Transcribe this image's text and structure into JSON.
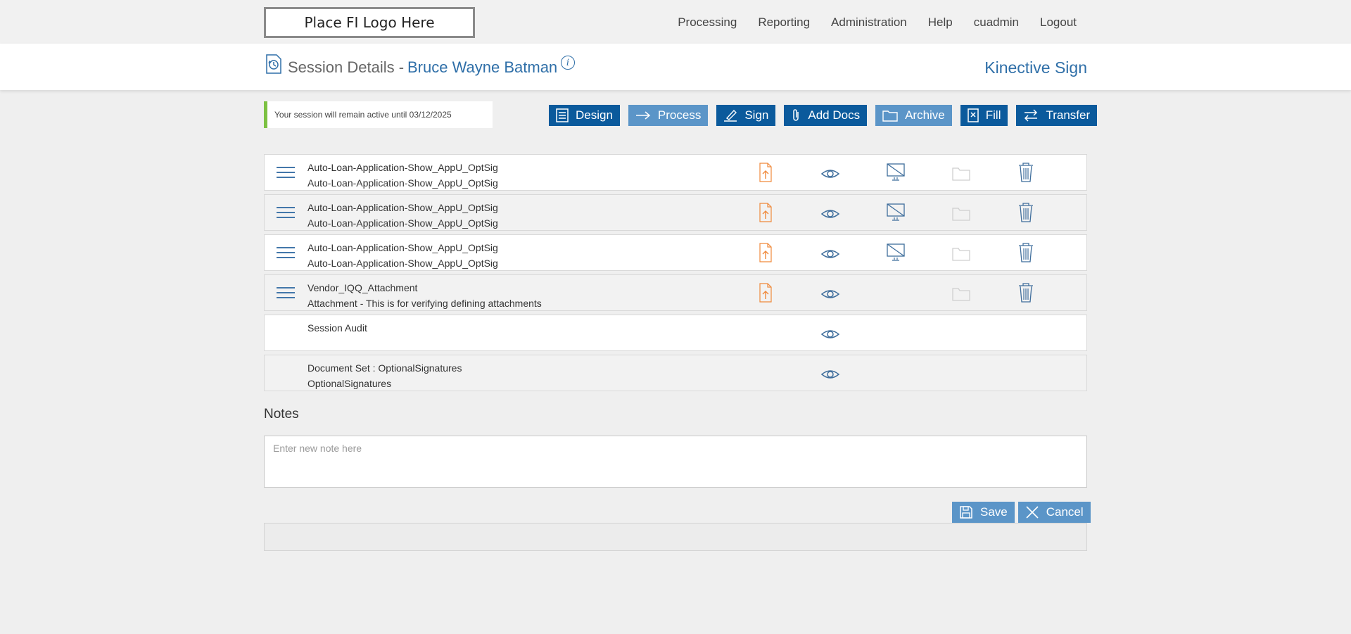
{
  "topbar": {
    "logo_text": "Place FI Logo Here",
    "nav": [
      "Processing",
      "Reporting",
      "Administration",
      "Help",
      "cuadmin",
      "Logout"
    ]
  },
  "header": {
    "title": "Session Details -",
    "customer_name": "Bruce Wayne Batman",
    "info_glyph": "i",
    "brand": "Kinective Sign"
  },
  "notice": {
    "text": "Your session will remain active until 03/12/2025",
    "accent_color": "#7cc142"
  },
  "toolbar": {
    "buttons": [
      {
        "label": "Design",
        "icon": "design-icon",
        "style": "dark"
      },
      {
        "label": "Process",
        "icon": "arrow-right-icon",
        "style": "light"
      },
      {
        "label": "Sign",
        "icon": "pen-icon",
        "style": "dark"
      },
      {
        "label": "Add Docs",
        "icon": "paperclip-icon",
        "style": "dark"
      },
      {
        "label": "Archive",
        "icon": "folder-icon",
        "style": "light"
      },
      {
        "label": "Fill",
        "icon": "fill-icon",
        "style": "dark"
      },
      {
        "label": "Transfer",
        "icon": "transfer-icon",
        "style": "dark"
      }
    ]
  },
  "documents": [
    {
      "line1": "Auto-Loan-Application-Show_AppU_OptSig",
      "line2": "Auto-Loan-Application-Show_AppU_OptSig"
    },
    {
      "line1": "Auto-Loan-Application-Show_AppU_OptSig",
      "line2": "Auto-Loan-Application-Show_AppU_OptSig"
    },
    {
      "line1": "Auto-Loan-Application-Show_AppU_OptSig",
      "line2": "Auto-Loan-Application-Show_AppU_OptSig"
    },
    {
      "line1": "Vendor_IQQ_Attachment",
      "line2": "Attachment - This is for verifying defining attachments"
    },
    {
      "line1": "Session Audit",
      "line2": ""
    },
    {
      "line1": "Document Set : OptionalSignatures",
      "line2": "OptionalSignatures"
    }
  ],
  "notes": {
    "title": "Notes",
    "placeholder": "Enter new note here"
  },
  "actions": {
    "save_label": "Save",
    "cancel_label": "Cancel"
  },
  "colors": {
    "primary": "#0b5a9c",
    "primary_light": "#5b95c8",
    "link": "#2f6fa8",
    "upload_orange": "#f08a3c"
  }
}
